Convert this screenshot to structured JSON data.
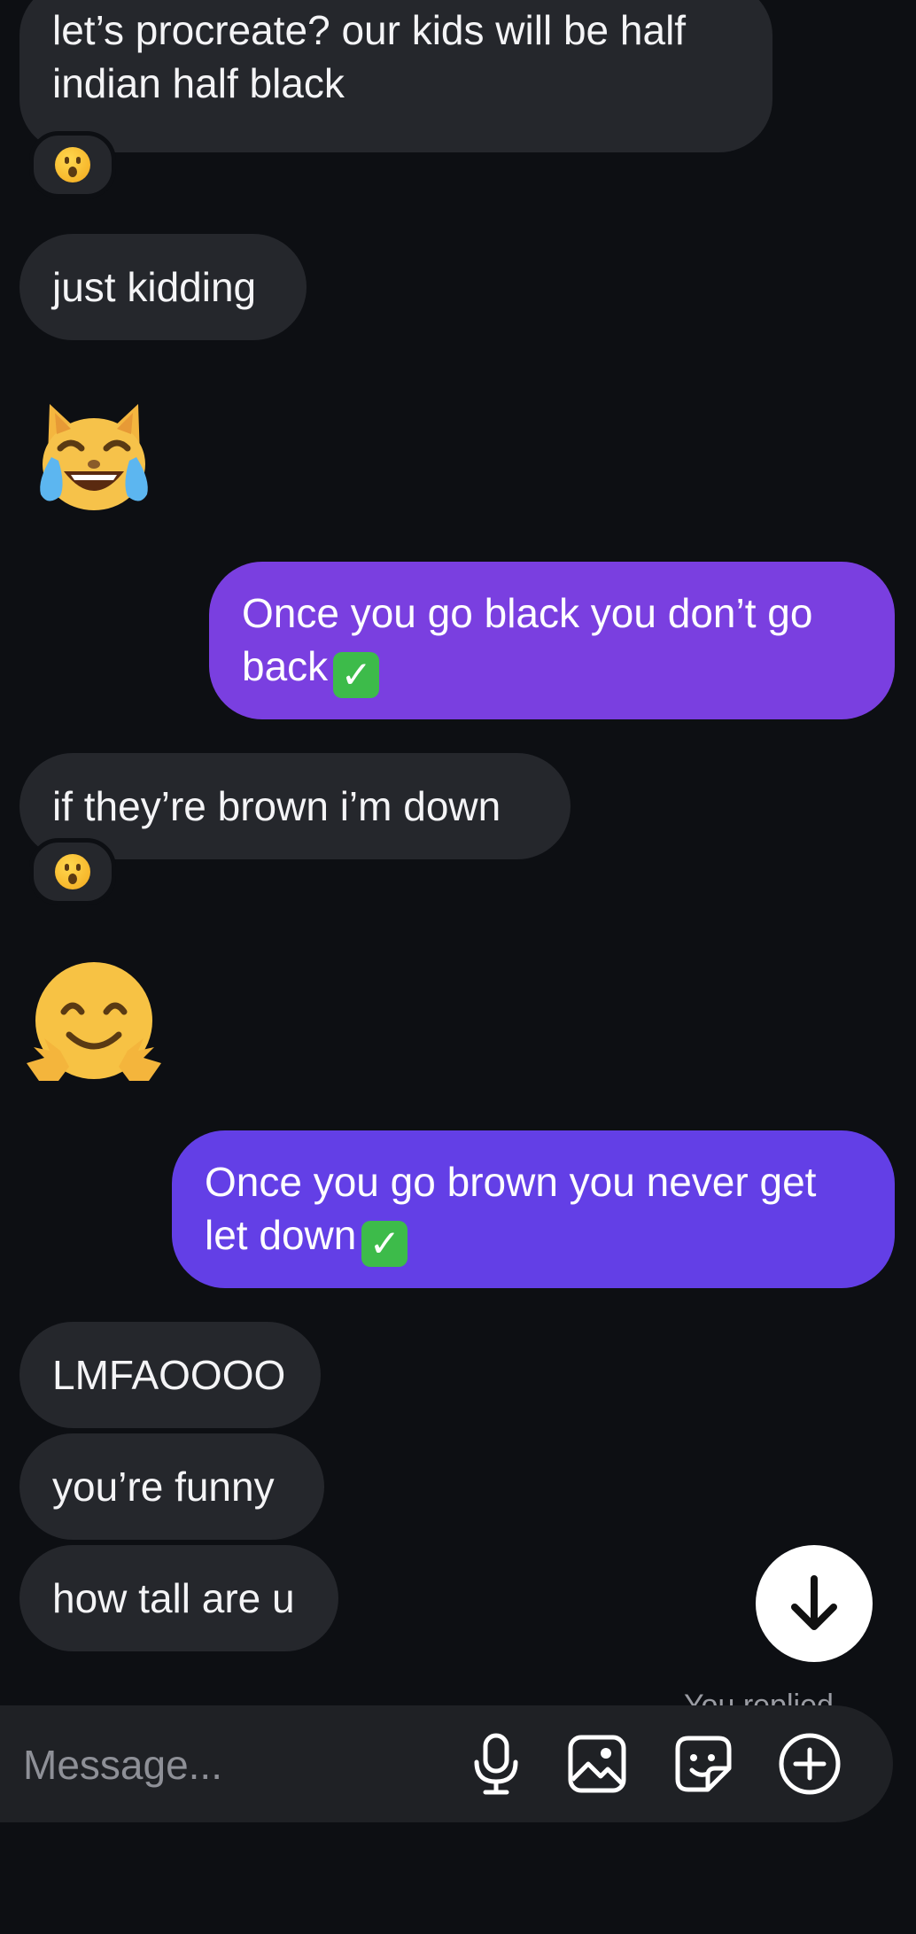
{
  "messages": [
    {
      "from": "them",
      "text_line1": "let’s procreate? our kids will be half",
      "text_line2": "indian half black",
      "reaction": "surprised"
    },
    {
      "from": "them",
      "text": "just kidding"
    },
    {
      "from": "them",
      "emoji": "cat-tears-of-joy"
    },
    {
      "from": "me",
      "text_line1": "Once you go black you don’t go",
      "text_line2": "back",
      "suffix_emoji": "check-mark-button"
    },
    {
      "from": "them",
      "text": "if they’re brown i’m down",
      "reaction": "surprised"
    },
    {
      "from": "them",
      "emoji": "hugging-face"
    },
    {
      "from": "me",
      "text_line1": "Once you go brown you never get",
      "text_line2": "let down",
      "suffix_emoji": "check-mark-button"
    },
    {
      "from": "them",
      "text": "LMFAOOOO"
    },
    {
      "from": "them",
      "text": "you’re funny"
    },
    {
      "from": "them",
      "text": "how tall are u"
    }
  ],
  "status": {
    "replied_note": "You replied"
  },
  "composer": {
    "placeholder": "Message...",
    "icons": [
      "microphone-icon",
      "gallery-icon",
      "sticker-icon",
      "plus-icon"
    ]
  },
  "colors": {
    "background": "#0d0f13",
    "incoming_bubble": "#25272c",
    "outgoing_bubble_1": "#7a3fe0",
    "outgoing_bubble_2": "#633fe6",
    "composer": "#1f2125"
  }
}
